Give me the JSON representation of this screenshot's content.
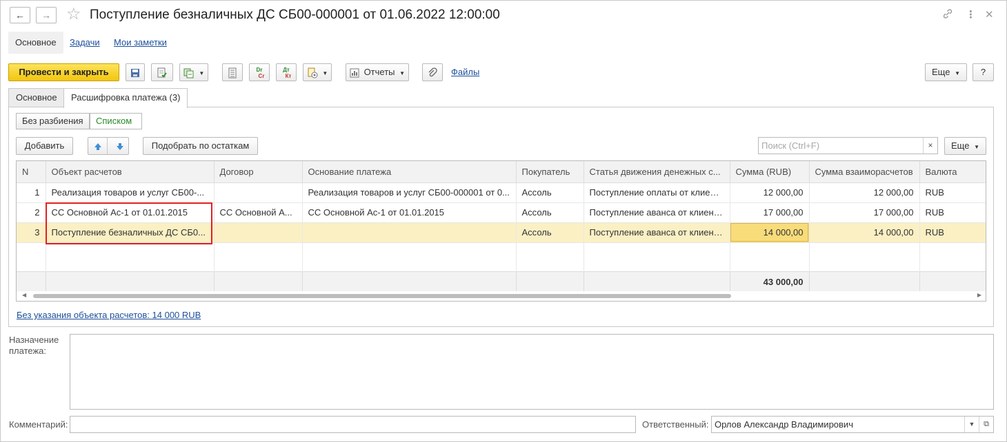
{
  "window": {
    "title": "Поступление безналичных ДС СБ00-000001 от 01.06.2022 12:00:00",
    "back_icon": "arrow-left-icon",
    "forward_icon": "arrow-right-icon",
    "star_icon": "star-icon"
  },
  "section_tabs": [
    "Основное",
    "Задачи",
    "Мои заметки"
  ],
  "toolbar": {
    "post_close": "Провести и закрыть",
    "reports": "Отчеты",
    "files": "Файлы",
    "more": "Еще",
    "help": "?"
  },
  "panel_tabs": [
    "Основное",
    "Расшифровка платежа (3)"
  ],
  "mode": {
    "options": [
      "Без разбиения",
      "Списком"
    ],
    "selected": "Списком"
  },
  "grid_toolbar": {
    "add": "Добавить",
    "pick": "Подобрать по остаткам",
    "search_placeholder": "Поиск (Ctrl+F)",
    "clear": "×",
    "more": "Еще"
  },
  "table": {
    "columns": [
      "N",
      "Объект расчетов",
      "Договор",
      "Основание платежа",
      "Покупатель",
      "Статья движения денежных с...",
      "Сумма (RUB)",
      "Сумма взаиморасчетов",
      "Валюта"
    ],
    "rows": [
      [
        "1",
        "Реализация товаров и услуг СБ00-...",
        "",
        "Реализация товаров и услуг СБ00-000001 от 0...",
        "Ассоль",
        "Поступление оплаты от клиент...",
        "12 000,00",
        "12 000,00",
        "RUB"
      ],
      [
        "2",
        "СС Основной Ас-1 от 01.01.2015",
        "СС Основной А...",
        "СС Основной Ас-1 от 01.01.2015",
        "Ассоль",
        "Поступление аванса от клиент...",
        "17 000,00",
        "17 000,00",
        "RUB"
      ],
      [
        "3",
        "Поступление безналичных ДС СБ0...",
        "",
        "",
        "Ассоль",
        "Поступление аванса от клиент...",
        "14 000,00",
        "14 000,00",
        "RUB"
      ]
    ],
    "total": "43 000,00",
    "selected_row": 3
  },
  "unassigned_link": "Без указания объекта расчетов: 14 000 RUB",
  "purpose_label": "Назначение платежа:",
  "comment_label": "Комментарий:",
  "responsible_label": "Ответственный:",
  "responsible_value": "Орлов Александр Владимирович",
  "colors": {
    "accent_yellow": "#f2c60f",
    "selection": "#fbf0c4",
    "link": "#1c4f9c",
    "highlight_box": "#e02020"
  }
}
